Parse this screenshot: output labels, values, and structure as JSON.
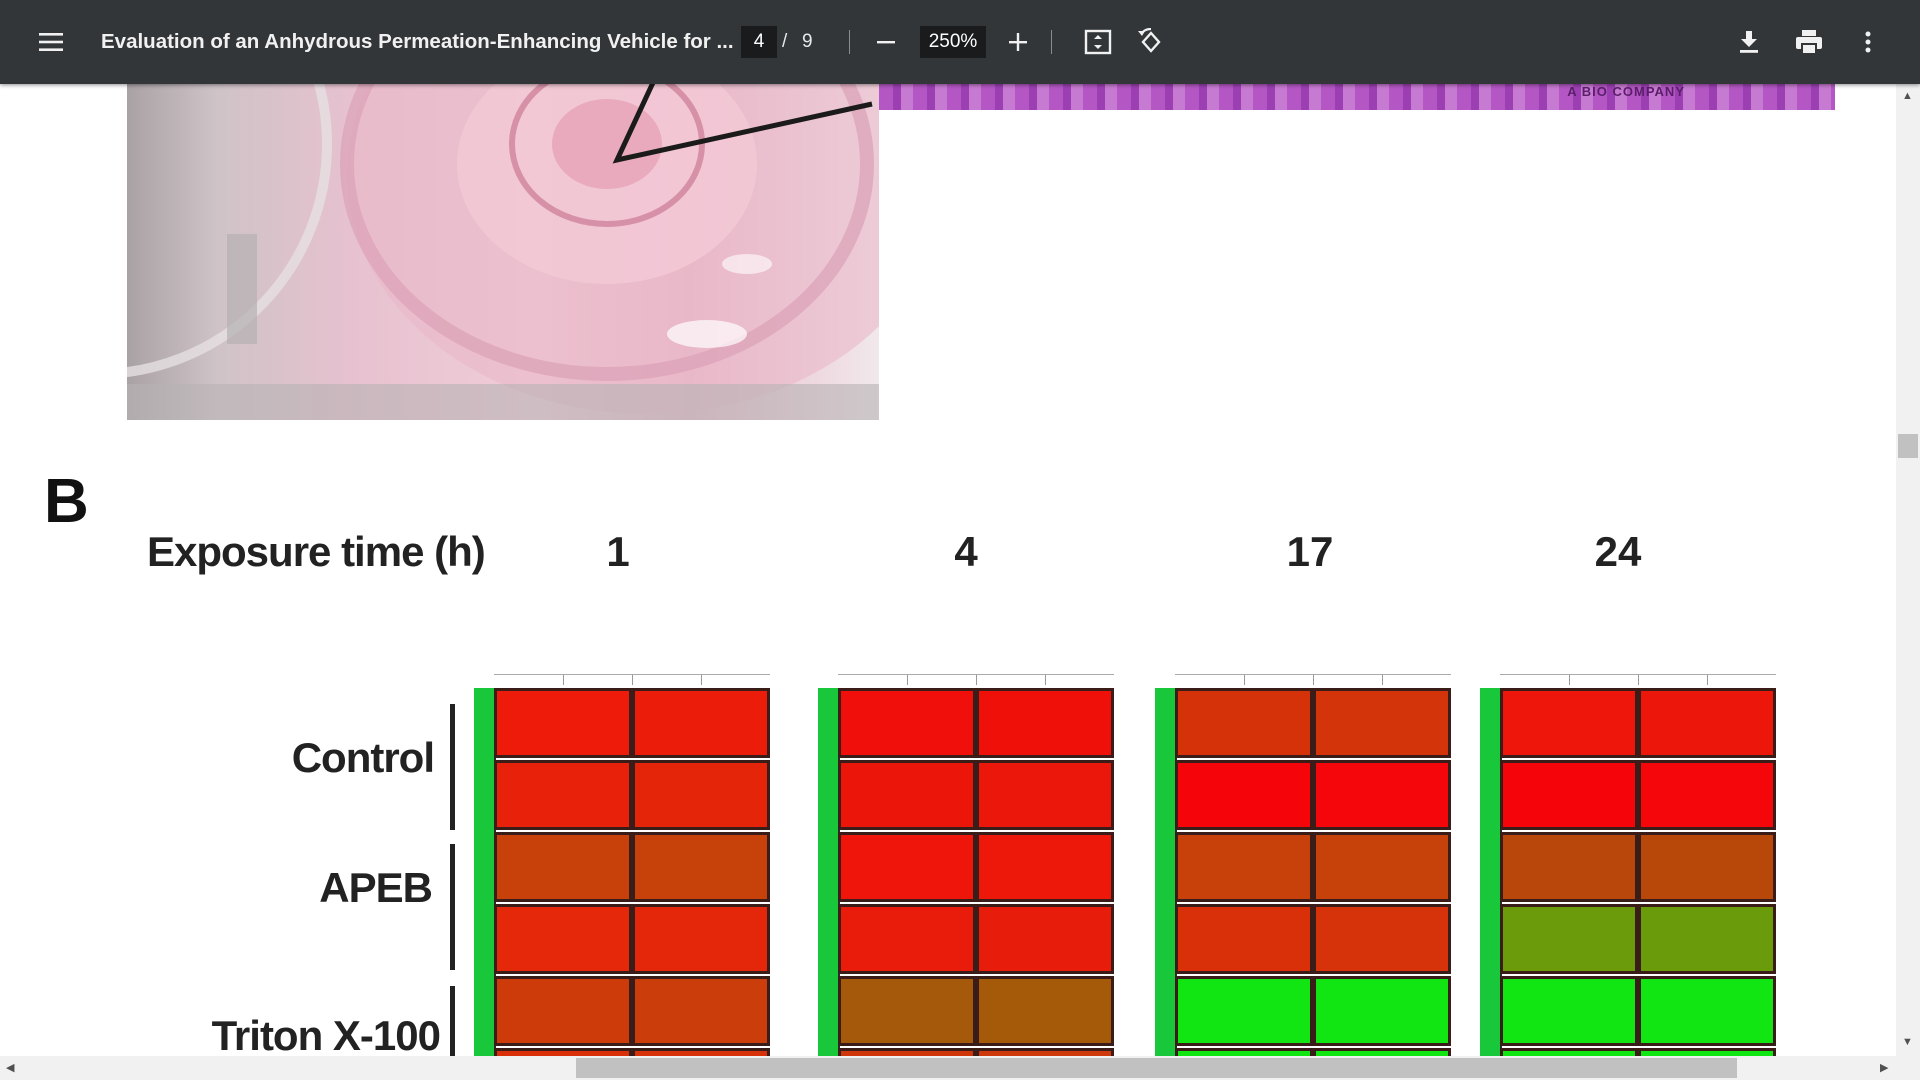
{
  "toolbar": {
    "title": "Evaluation of an Anhydrous Permeation-Enhancing Vehicle for ...",
    "current_page": "4",
    "page_separator": "/",
    "total_pages": "9",
    "zoom": "250%",
    "icons": [
      "menu-icon",
      "zoom-out-icon",
      "zoom-in-icon",
      "fit-page-icon",
      "rotate-icon",
      "download-icon",
      "print-icon",
      "more-icon"
    ]
  },
  "document": {
    "figure_letter": "B",
    "exposure_label": "Exposure time (h)",
    "time_points": [
      "1",
      "4",
      "17",
      "24"
    ],
    "row_groups": [
      "Control",
      "APEB",
      "Triton X-100"
    ],
    "histology_text": "A BIO COMPANY"
  },
  "colors": {
    "toolbar_bg": "#323639",
    "red": "#f20a0a",
    "green": "#12e612",
    "stripe_green": "#18c83a"
  },
  "chart_data": {
    "type": "heatmap",
    "title": "",
    "columns_label": "Exposure time (h)",
    "columns": [
      "1",
      "4",
      "17",
      "24"
    ],
    "row_groups": [
      "Control",
      "APEB",
      "Triton X-100"
    ],
    "rows_per_group": 2,
    "cells_per_row": 2,
    "cell_colors": {
      "1": [
        [
          "#ee1a0a",
          "#ec1c0a"
        ],
        [
          "#e8220a",
          "#e5250a"
        ],
        [
          "#c8400a",
          "#c7420a"
        ],
        [
          "#e5280a",
          "#e4270a"
        ],
        [
          "#cd3b0a",
          "#cb3d0a"
        ],
        [
          "#d9300a",
          "#d7320a"
        ]
      ],
      "4": [
        [
          "#f00f0a",
          "#ef100a"
        ],
        [
          "#ec150a",
          "#ea170a"
        ],
        [
          "#ef150a",
          "#ed170a"
        ],
        [
          "#e91b0a",
          "#e81c0a"
        ],
        [
          "#a45a0a",
          "#a55a0a"
        ],
        [
          "#cf370a",
          "#cd390a"
        ]
      ],
      "17": [
        [
          "#d6320a",
          "#d4340a"
        ],
        [
          "#f5050a",
          "#f4060a"
        ],
        [
          "#c8400a",
          "#c7420a"
        ],
        [
          "#d9300a",
          "#d6330a"
        ],
        [
          "#12e612",
          "#12e612"
        ],
        [
          "#12e612",
          "#12e612"
        ]
      ],
      "24": [
        [
          "#ee150a",
          "#ed160a"
        ],
        [
          "#f5050a",
          "#f4060a"
        ],
        [
          "#b9460a",
          "#b8470a"
        ],
        [
          "#6b9a0a",
          "#6a9b0a"
        ],
        [
          "#12e612",
          "#12e612"
        ],
        [
          "#12e612",
          "#12e612"
        ]
      ]
    }
  }
}
